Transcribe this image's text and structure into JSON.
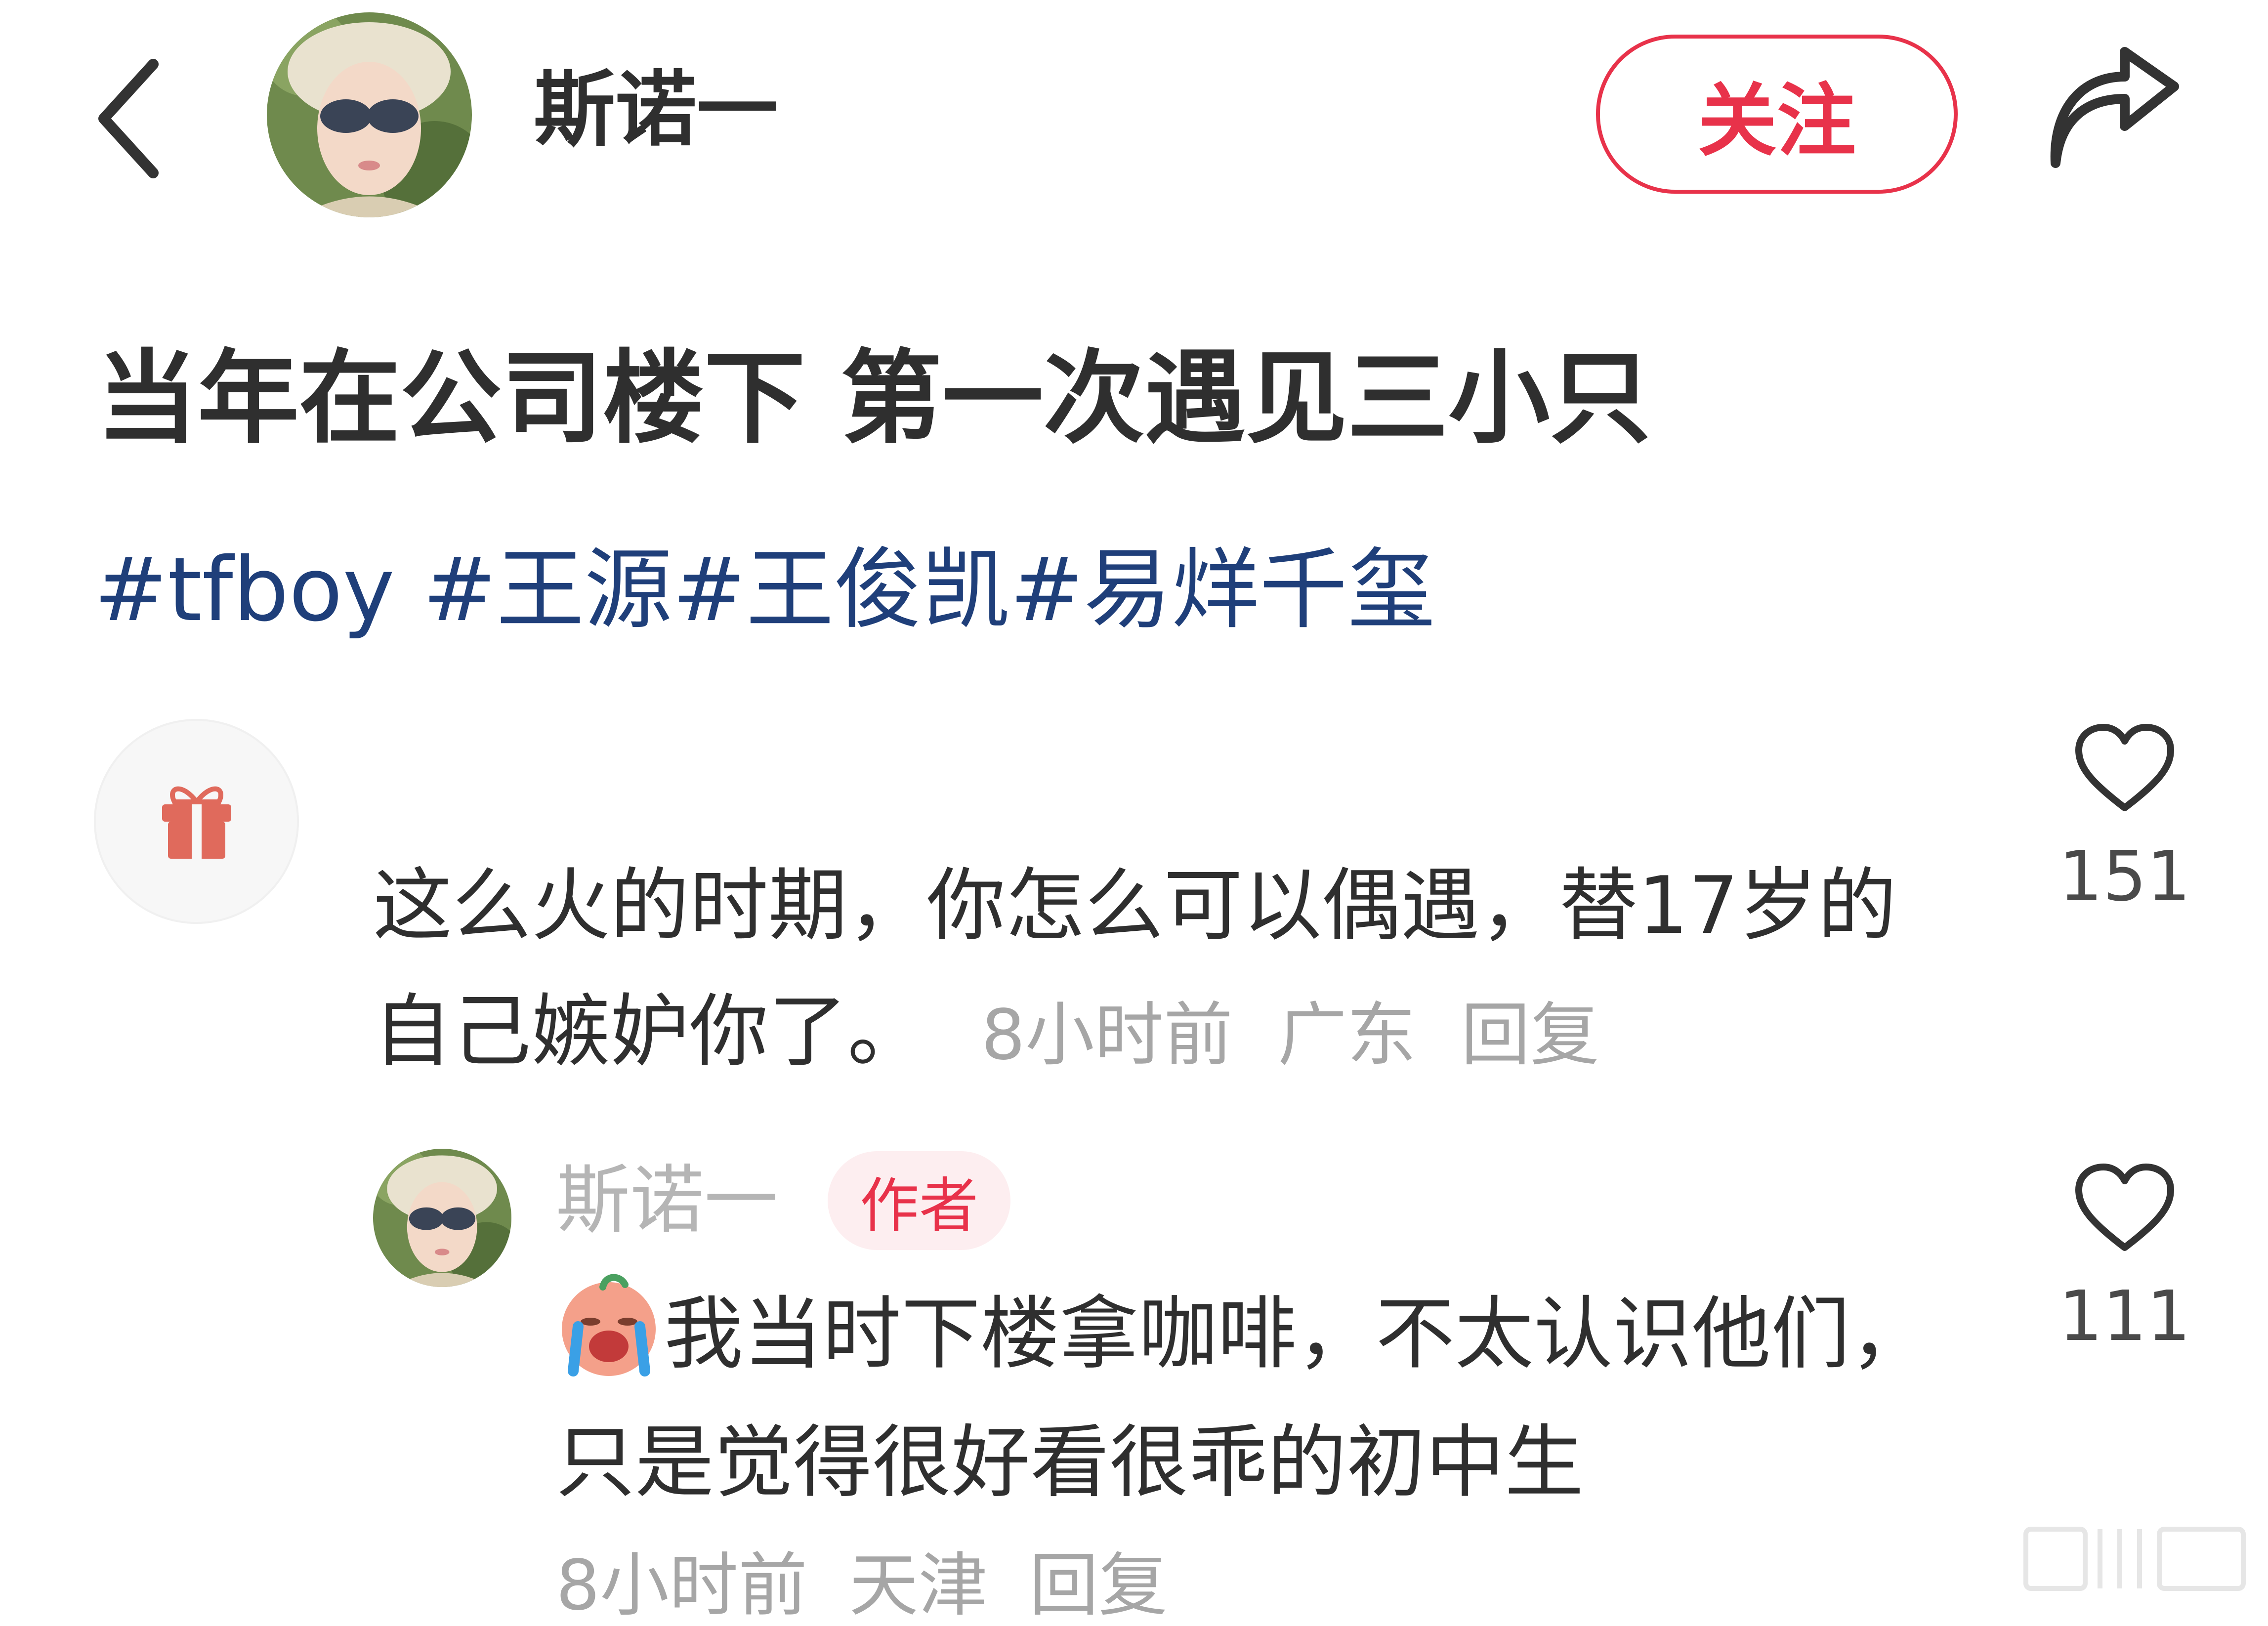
{
  "header": {
    "author_name": "斯诺一",
    "follow_label": "关注",
    "back_icon": "chevron-left-icon",
    "share_icon": "share-arrow-icon"
  },
  "post": {
    "title": "当年在公司楼下 第一次遇见三小只",
    "tags": [
      "#tfboy",
      " #王源",
      "#王俊凯",
      "#易烊千玺"
    ]
  },
  "comments": [
    {
      "avatar_icon": "gift-icon",
      "text": "这么火的时期，你怎么可以偶遇，替17岁的自己嫉妒你了。",
      "time": "8小时前",
      "location": "广东",
      "reply_label": "回复",
      "like_count": "151"
    }
  ],
  "reply": {
    "author": "斯诺一",
    "badge": "作者",
    "emoji_icon": "crying-emoji-icon",
    "text": "我当时下楼拿咖啡，不太认识他们，只是觉得很好看很乖的初中生",
    "time": "8小时前",
    "location": "天津",
    "reply_label": "回复",
    "like_count": "111"
  },
  "colors": {
    "accent": "#e8324a",
    "tag": "#1f3f7a",
    "meta": "#a6a6a6",
    "text": "#2f2f2f"
  }
}
